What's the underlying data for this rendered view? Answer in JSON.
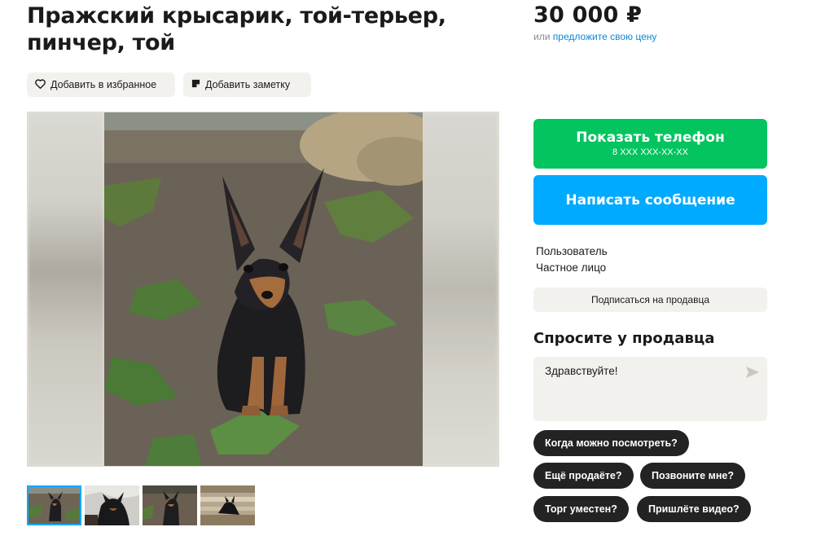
{
  "listing": {
    "title": "Пражский крысарик, той-терьер, пинчер, той",
    "price": "30 000 ₽",
    "price_prefix": "или",
    "price_offer_link": "предложите свою цену"
  },
  "actions": {
    "favorite_label": "Добавить в избранное",
    "note_label": "Добавить заметку"
  },
  "gallery": {
    "thumbnail_count": 4,
    "active_index": 0
  },
  "contact": {
    "show_phone_label": "Показать телефон",
    "phone_mask": "8 XXX XXX-XX-XX",
    "write_message_label": "Написать сообщение"
  },
  "seller": {
    "name": "Пользователь",
    "type": "Частное лицо",
    "subscribe_label": "Подписаться на продавца"
  },
  "ask": {
    "title": "Спросите у продавца",
    "message_value": "Здравствуйте!",
    "quick_questions": [
      "Когда можно посмотреть?",
      "Ещё продаёте?",
      "Позвоните мне?",
      "Торг уместен?",
      "Пришлёте видео?"
    ]
  },
  "colors": {
    "call_button": "#04c45f",
    "message_button": "#00aaff",
    "link": "#0a88d4",
    "chip": "#232323"
  }
}
